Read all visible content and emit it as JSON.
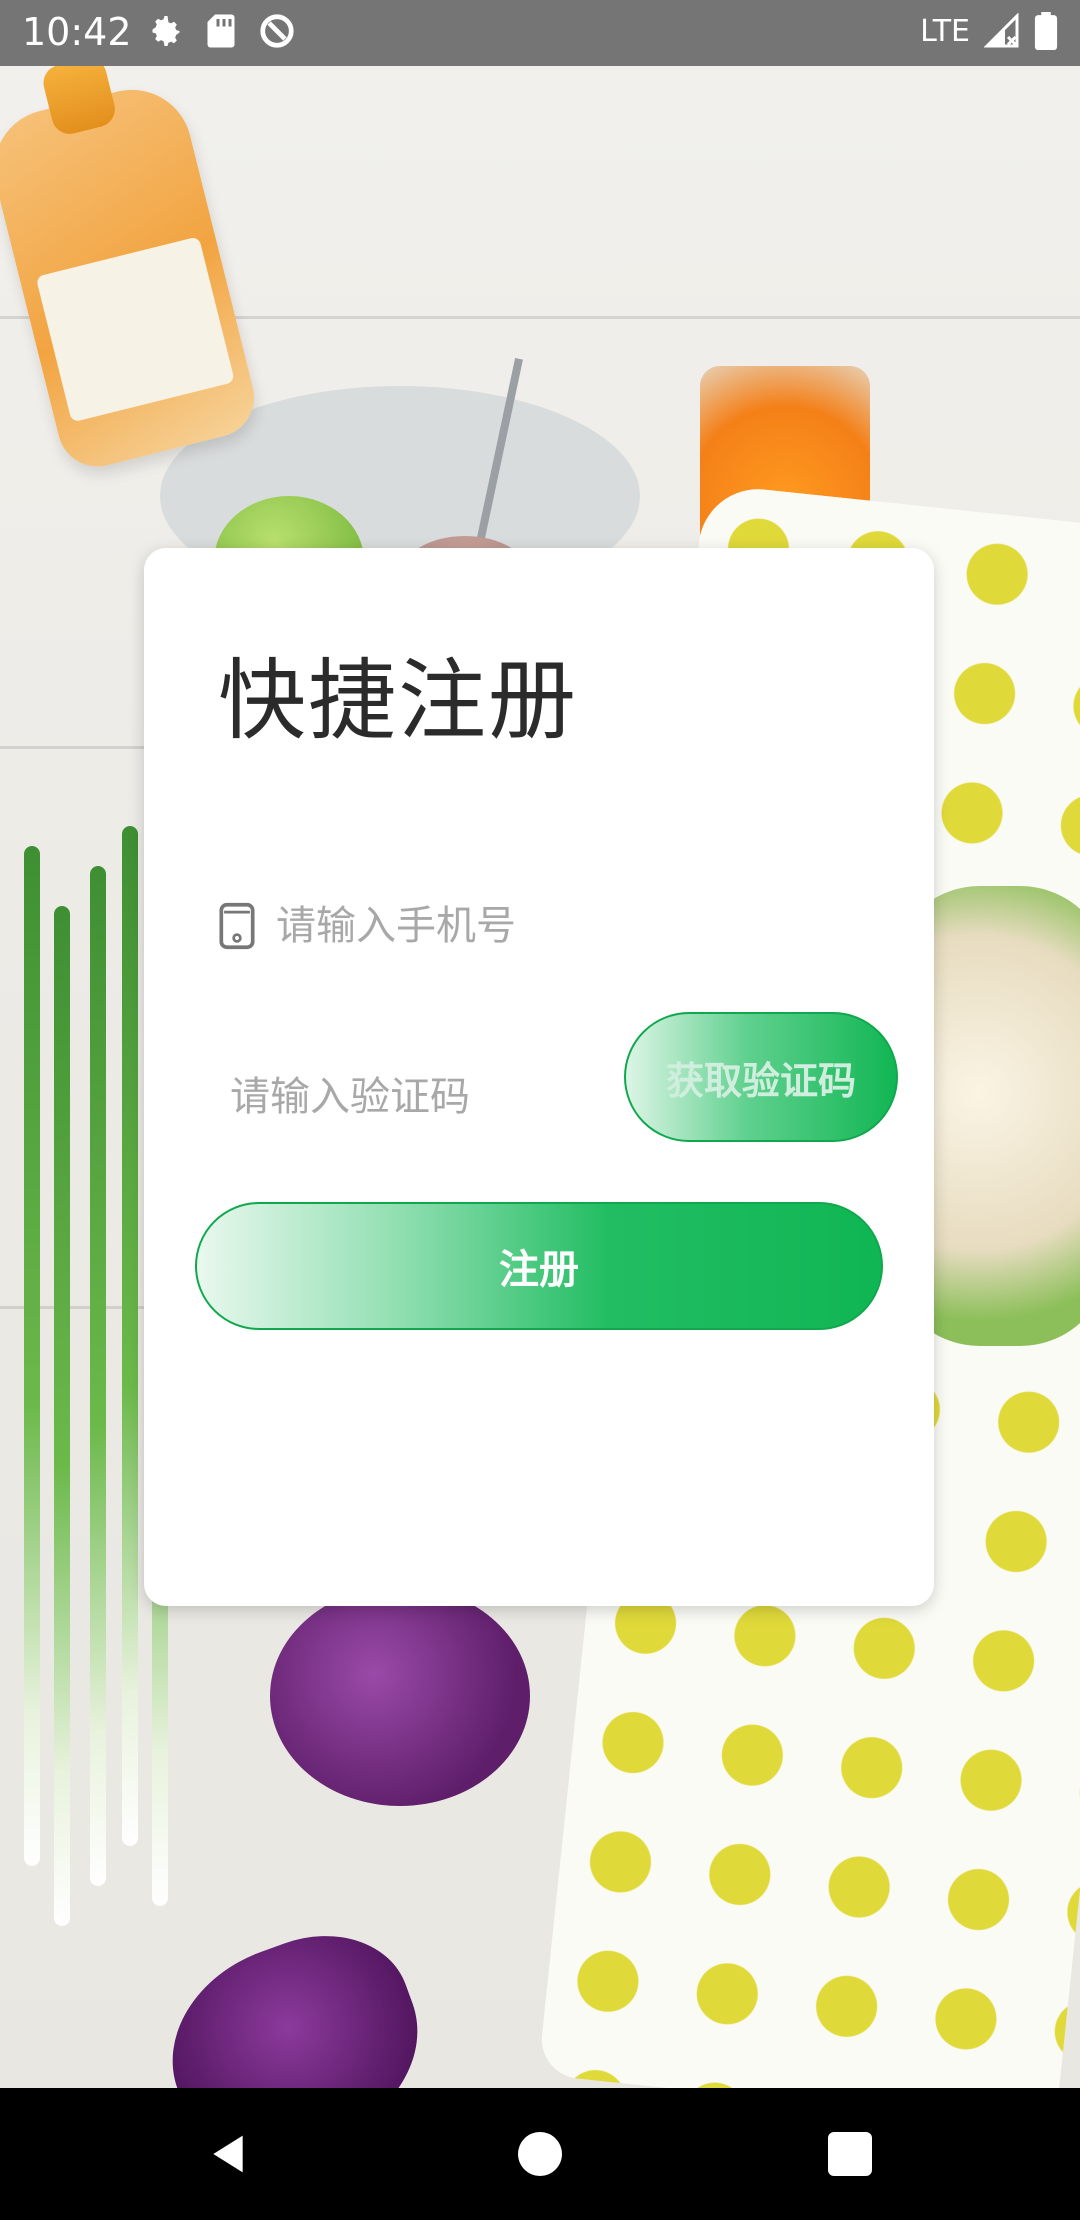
{
  "status_bar": {
    "time": "10:42",
    "network": "LTE",
    "icons": [
      "settings-icon",
      "sd-card-icon",
      "sync-icon",
      "signal-icon",
      "battery-icon"
    ]
  },
  "register_card": {
    "title": "快捷注册",
    "phone_placeholder": "请输入手机号",
    "code_placeholder": "请输入验证码",
    "get_code_label": "获取验证码",
    "submit_label": "注册"
  },
  "colors": {
    "primary_green": "#10b653",
    "placeholder_grey": "#a8a8a8",
    "status_bar": "#757575"
  },
  "nav_bar": {
    "buttons": [
      "back-icon",
      "home-icon",
      "recents-icon"
    ]
  }
}
